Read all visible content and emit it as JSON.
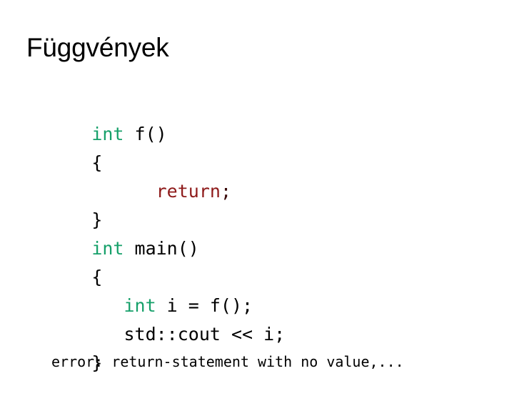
{
  "slide": {
    "title": "Függvények",
    "background_color": "#ffffff",
    "text_color": "#000000"
  },
  "colors": {
    "keyword_green": "#16a06a",
    "keyword_red": "#8e1a1a",
    "plain_black": "#000000"
  },
  "code": {
    "language": "cpp",
    "lines": [
      {
        "indent": "",
        "keyword": "int",
        "keyword_color": "green",
        "rest": " f()"
      },
      {
        "indent": "",
        "keyword": "",
        "keyword_color": "none",
        "rest": "{"
      },
      {
        "indent": "      ",
        "keyword": "return",
        "keyword_color": "red",
        "rest": ";"
      },
      {
        "indent": "",
        "keyword": "",
        "keyword_color": "none",
        "rest": "}"
      },
      {
        "indent": "",
        "keyword": "int",
        "keyword_color": "green",
        "rest": " main()"
      },
      {
        "indent": "",
        "keyword": "",
        "keyword_color": "none",
        "rest": "{"
      },
      {
        "indent": "   ",
        "keyword": "int",
        "keyword_color": "green",
        "rest": " i = f();"
      },
      {
        "indent": "   ",
        "keyword": "",
        "keyword_color": "none",
        "rest": "std::cout << i;"
      },
      {
        "indent": "",
        "keyword": "",
        "keyword_color": "none",
        "rest": "}"
      }
    ]
  },
  "compiler_message": {
    "text": "error: return-statement with no value,..."
  }
}
